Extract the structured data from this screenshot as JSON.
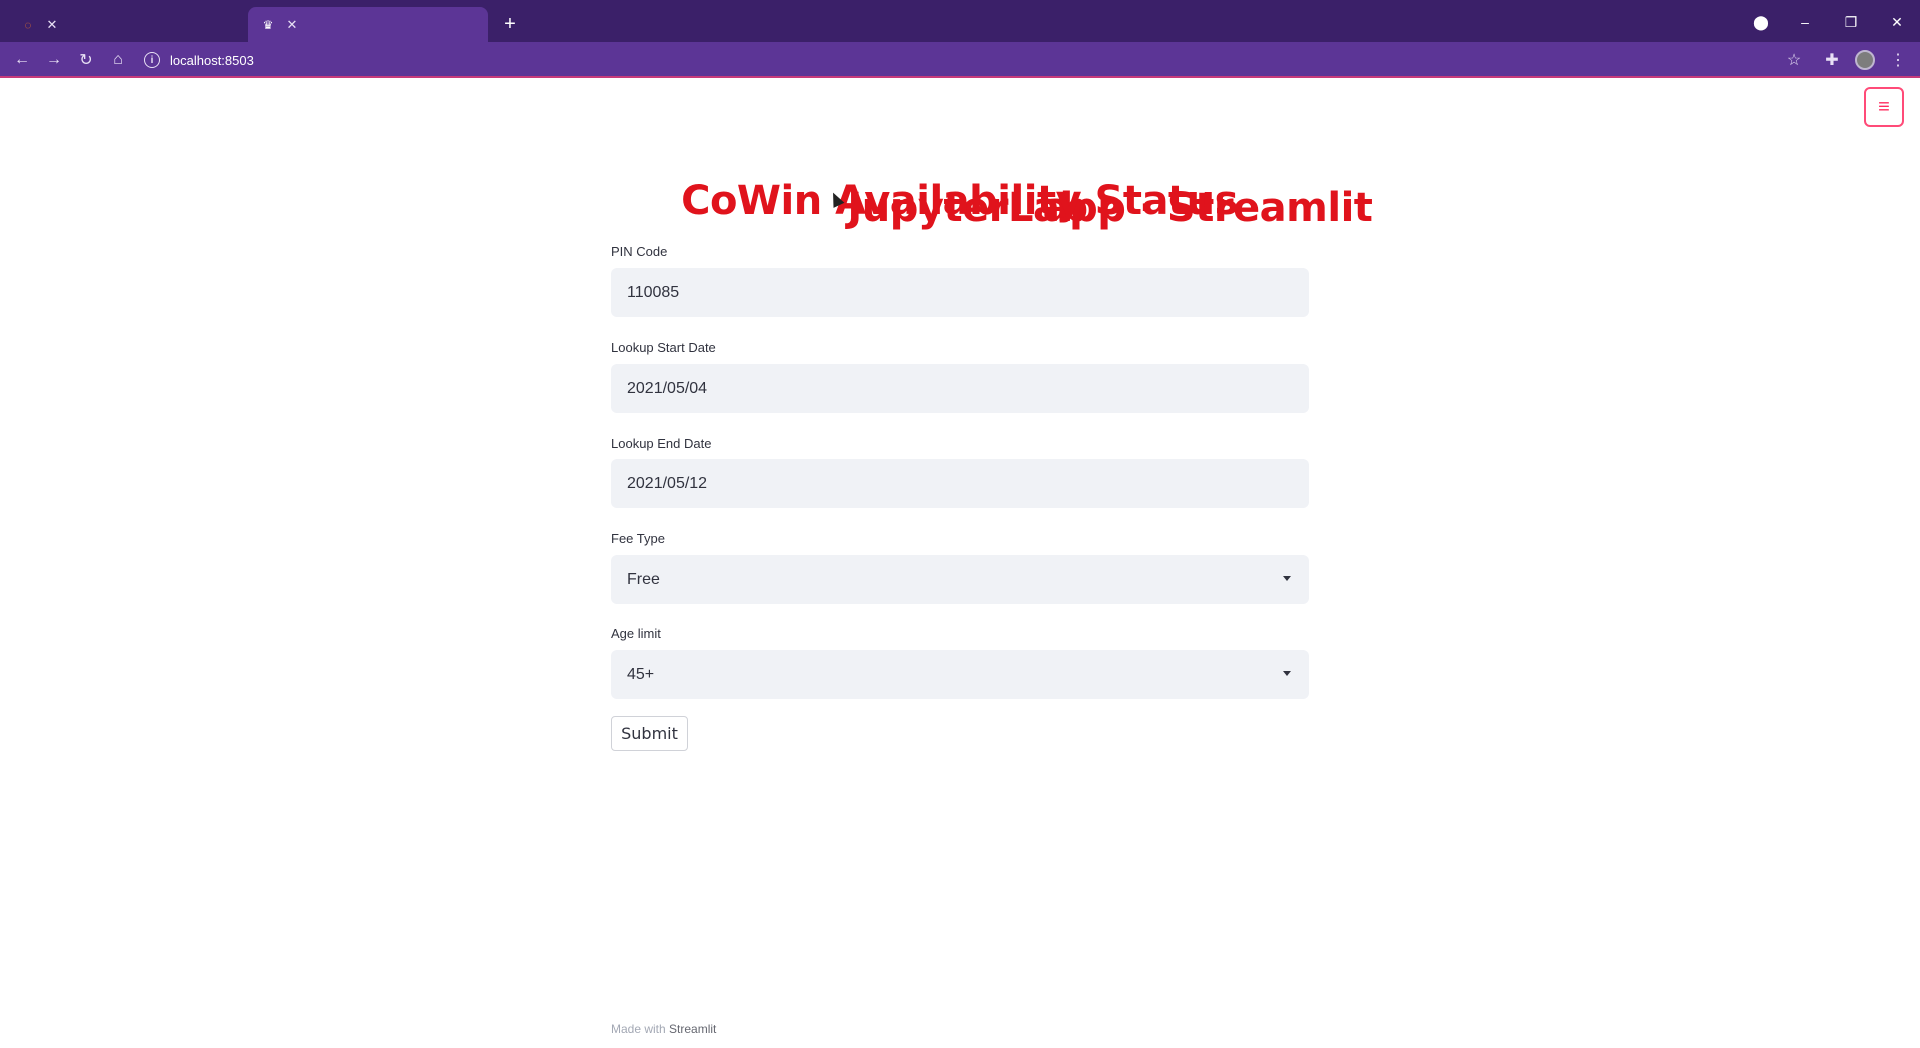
{
  "browser": {
    "tabs": [
      {
        "title": "JupyterLab",
        "favicon": "jupyter-icon",
        "active": false
      },
      {
        "title": "app · Streamlit",
        "favicon": "streamlit-icon",
        "active": true
      }
    ],
    "url": "localhost:8503",
    "new_tab_symbol": "+",
    "window_controls": {
      "minimize": "–",
      "maximize": "❐",
      "close": "✕"
    }
  },
  "app": {
    "title": "CoWin Availability Status",
    "fields": {
      "pin": {
        "label": "PIN Code",
        "value": "110085"
      },
      "start_date": {
        "label": "Lookup Start Date",
        "value": "2021/05/04"
      },
      "end_date": {
        "label": "Lookup End Date",
        "value": "2021/05/12"
      },
      "fee_type": {
        "label": "Fee Type",
        "value": "Free"
      },
      "age_limit": {
        "label": "Age limit",
        "value": "45+"
      }
    },
    "submit_label": "Submit",
    "menu_symbol": "≡",
    "footer": {
      "prefix": "Made with",
      "brand": "Streamlit"
    }
  },
  "colors": {
    "title": "#e0131c",
    "tab_bar": "#3b2069",
    "toolbar": "#5c3596",
    "menu_accent": "#ff4b78",
    "field_bg": "#f0f2f6"
  }
}
